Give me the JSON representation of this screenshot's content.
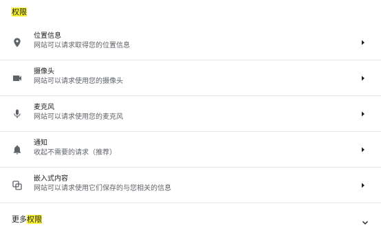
{
  "section": {
    "title": "权限"
  },
  "permissions": [
    {
      "title": "位置信息",
      "desc": "网站可以请求取得您的位置信息",
      "icon": "location-pin-icon"
    },
    {
      "title": "摄像头",
      "desc": "网站可以请求使用您的摄像头",
      "icon": "camera-icon"
    },
    {
      "title": "麦克风",
      "desc": "网站可以请求使用您的麦克风",
      "icon": "microphone-icon"
    },
    {
      "title": "通知",
      "desc": "收起不需要的请求（推荐）",
      "icon": "bell-icon"
    },
    {
      "title": "嵌入式内容",
      "desc": "网站可以请求使用它们保存的与您相关的信息",
      "icon": "embedded-content-icon"
    }
  ],
  "more": {
    "prefix": "更多",
    "highlight": "权限"
  },
  "colors": {
    "highlight": "#f8f22b",
    "divider": "#e6e6e6",
    "secondary_text": "#5f6368",
    "icon": "#5f6368"
  }
}
